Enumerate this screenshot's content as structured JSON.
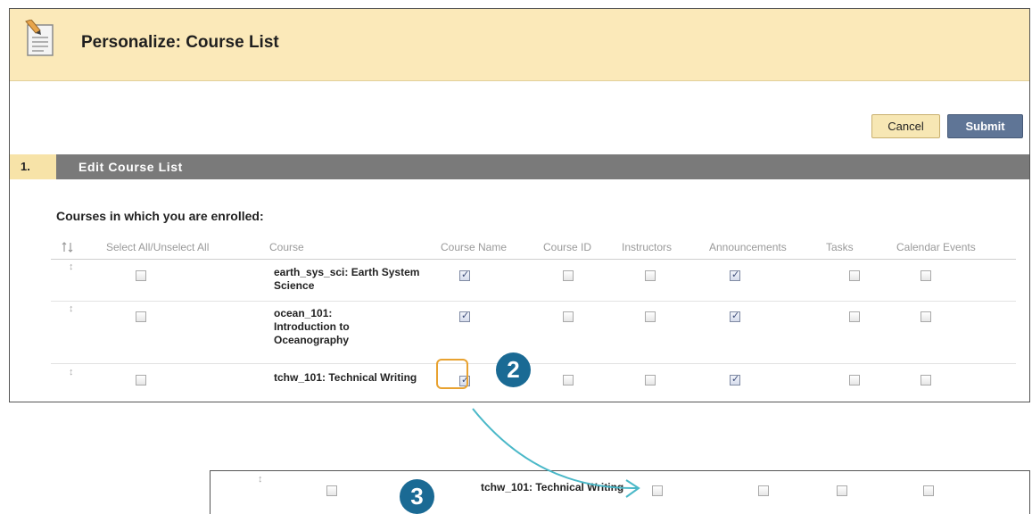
{
  "page": {
    "title": "Personalize: Course List"
  },
  "actions": {
    "cancel_label": "Cancel",
    "submit_label": "Submit"
  },
  "step": {
    "number": "1.",
    "label": "Edit Course List"
  },
  "section": {
    "title": "Courses in which you are enrolled:"
  },
  "table": {
    "reorder_icon": "reorder-arrows-icon",
    "columns": [
      "Select All/Unselect All",
      "Course",
      "Course Name",
      "Course ID",
      "Instructors",
      "Announcements",
      "Tasks",
      "Calendar Events"
    ],
    "rows": [
      {
        "course": "earth_sys_sci: Earth System Science",
        "select": false,
        "course_name": true,
        "course_id": false,
        "instructors": false,
        "announcements": true,
        "tasks": false,
        "calendar_events": false
      },
      {
        "course": "ocean_101: Introduction to Oceanography",
        "select": false,
        "course_name": true,
        "course_id": false,
        "instructors": false,
        "announcements": true,
        "tasks": false,
        "calendar_events": false
      },
      {
        "course": "tchw_101: Technical Writing",
        "select": false,
        "course_name": true,
        "course_id": false,
        "instructors": false,
        "announcements": true,
        "tasks": false,
        "calendar_events": false
      }
    ]
  },
  "callouts": {
    "step_two": "2",
    "step_three": "3"
  },
  "result_row": {
    "course": "tchw_101: Technical Writing",
    "select": false,
    "course_id": false,
    "instructors": false,
    "announcements": false,
    "tasks": false
  },
  "colors": {
    "header_bg": "#fbe9b9",
    "step_bar": "#7a7a7a",
    "submit": "#5f7596",
    "badge": "#1a6a94",
    "highlight": "#e8a230",
    "arrow": "#4ab8c8"
  }
}
